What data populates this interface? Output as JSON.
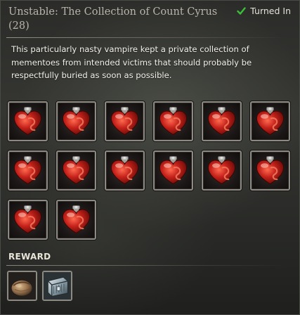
{
  "quest": {
    "title": "Unstable: The Collection of Count Cyrus (28)",
    "status_label": "Turned In",
    "description": "This particularly nasty vampire kept a private collection of mementoes from intended victims that should probably be respectfully buried as soon as possible."
  },
  "collection_items": [
    {
      "icon": "blood-heart-vial-icon"
    },
    {
      "icon": "blood-heart-vial-icon"
    },
    {
      "icon": "blood-heart-vial-icon"
    },
    {
      "icon": "blood-heart-vial-icon"
    },
    {
      "icon": "blood-heart-vial-icon"
    },
    {
      "icon": "blood-heart-vial-icon"
    },
    {
      "icon": "blood-heart-vial-icon"
    },
    {
      "icon": "blood-heart-vial-icon"
    },
    {
      "icon": "blood-heart-vial-icon"
    },
    {
      "icon": "blood-heart-vial-icon"
    },
    {
      "icon": "blood-heart-vial-icon"
    },
    {
      "icon": "blood-heart-vial-icon"
    },
    {
      "icon": "blood-heart-vial-icon"
    },
    {
      "icon": "blood-heart-vial-icon"
    }
  ],
  "reward": {
    "label": "REWARD",
    "items": [
      {
        "icon": "coin-pouch-icon"
      },
      {
        "icon": "steel-chest-icon"
      }
    ]
  },
  "colors": {
    "check_green": "#3bbf3b",
    "text_light": "#f2f0ea",
    "title_gray": "#b9b5aa",
    "heart_red": "#c4211a"
  }
}
